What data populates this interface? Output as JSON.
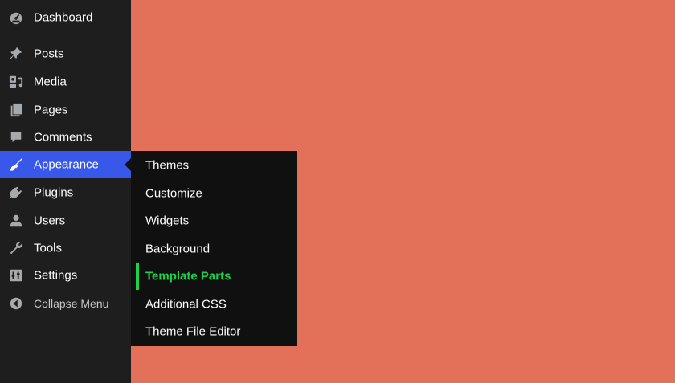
{
  "colors": {
    "sidebar_bg": "#1e1e1e",
    "submenu_bg": "#101010",
    "active_bg": "#3858e9",
    "current_accent": "#1ed14b",
    "content_bg": "#e37058"
  },
  "sidebar": {
    "items": [
      {
        "label": "Dashboard",
        "icon": "dashboard-icon"
      },
      {
        "label": "Posts",
        "icon": "pushpin-icon"
      },
      {
        "label": "Media",
        "icon": "media-icon"
      },
      {
        "label": "Pages",
        "icon": "pages-icon"
      },
      {
        "label": "Comments",
        "icon": "comment-icon"
      },
      {
        "label": "Appearance",
        "icon": "paintbrush-icon",
        "active": true
      },
      {
        "label": "Plugins",
        "icon": "plug-icon"
      },
      {
        "label": "Users",
        "icon": "user-icon"
      },
      {
        "label": "Tools",
        "icon": "wrench-icon"
      },
      {
        "label": "Settings",
        "icon": "settings-icon"
      }
    ],
    "collapse": {
      "label": "Collapse Menu",
      "icon": "collapse-arrow-icon"
    }
  },
  "submenu": {
    "items": [
      {
        "label": "Themes"
      },
      {
        "label": "Customize"
      },
      {
        "label": "Widgets"
      },
      {
        "label": "Background"
      },
      {
        "label": "Template Parts",
        "current": true
      },
      {
        "label": "Additional CSS"
      },
      {
        "label": "Theme File Editor"
      }
    ]
  }
}
